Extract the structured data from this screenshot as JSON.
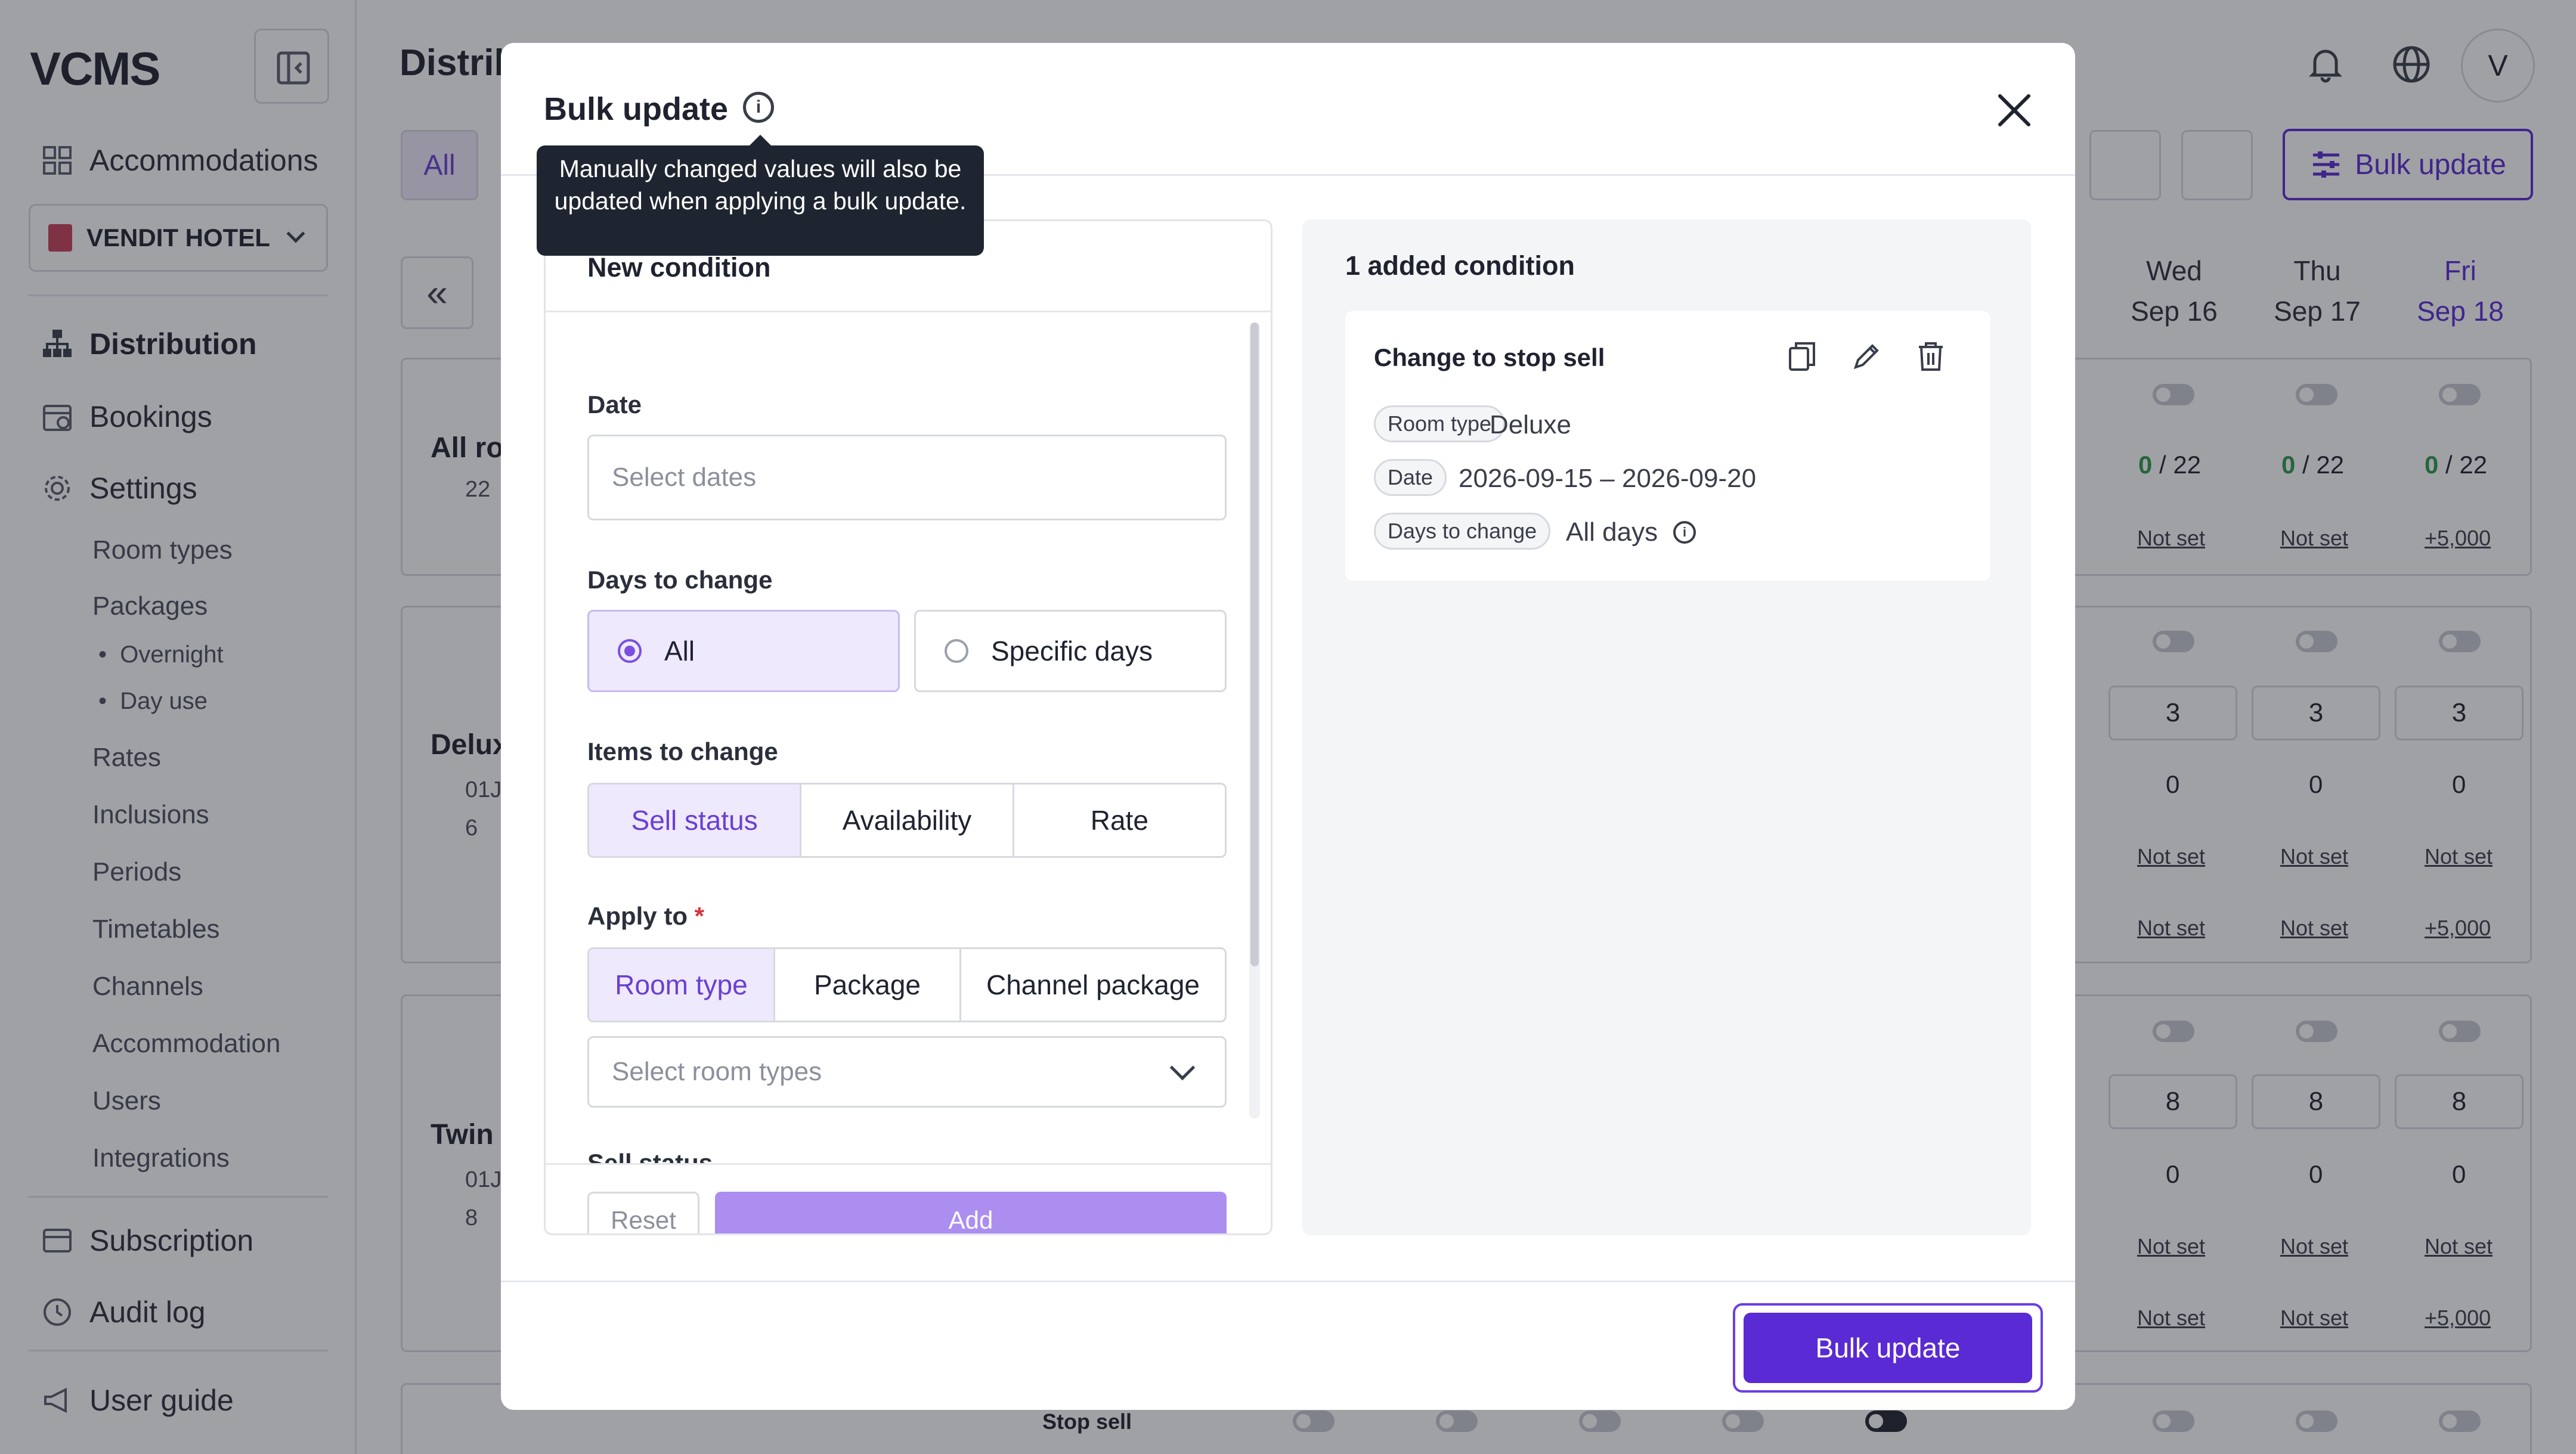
{
  "app": {
    "logo": "VCMS",
    "hotel": "VENDIT HOTEL",
    "page_title": "Distrib",
    "avatar": "V",
    "sidebar": {
      "accommodations": "Accommodations",
      "distribution": "Distribution",
      "bookings": "Bookings",
      "settings": "Settings",
      "settings_items": [
        "Room types",
        "Packages",
        "Rates",
        "Inclusions",
        "Periods",
        "Timetables",
        "Channels",
        "Accommodation",
        "Users",
        "Integrations"
      ],
      "packages_items": [
        "Overnight",
        "Day use"
      ],
      "subscription": "Subscription",
      "audit_log": "Audit log",
      "user_guide": "User guide"
    },
    "toolbar": {
      "filter_all": "All",
      "bulk_update": "Bulk update",
      "prev": "«"
    },
    "days": [
      {
        "dow": "Wed",
        "date": "Sep 16"
      },
      {
        "dow": "Thu",
        "date": "Sep 17"
      },
      {
        "dow": "Fri",
        "date": "Sep 18"
      }
    ],
    "grid": {
      "row_all": "All ro",
      "row_all_count": "22",
      "row_deluxe": "Delux",
      "row_deluxe_a": "01J",
      "row_deluxe_b": "6",
      "row_twin": "Twin",
      "row_twin_a": "01J",
      "row_twin_b": "8",
      "avail_all": [
        "0",
        "/ 22"
      ],
      "not_set": "Not set",
      "plus_price": "+5,000",
      "deluxe_units": "3",
      "twin_units": "8",
      "zero": "0",
      "stop_sell": "Stop sell"
    }
  },
  "modal": {
    "title": "Bulk update",
    "tooltip": "Manually changed values will also be updated when applying a bulk update.",
    "new_condition": {
      "heading": "New condition",
      "date_label": "Date",
      "date_placeholder": "Select dates",
      "days_label": "Days to change",
      "days_options": [
        "All",
        "Specific days"
      ],
      "items_label": "Items to change",
      "items_options": [
        "Sell status",
        "Availability",
        "Rate"
      ],
      "apply_label": "Apply to",
      "apply_required": "*",
      "apply_options": [
        "Room type",
        "Package",
        "Channel package"
      ],
      "room_types_placeholder": "Select room types",
      "next_label": "Sell status",
      "reset": "Reset",
      "add": "Add"
    },
    "added": {
      "heading": "1 added condition",
      "condition": {
        "title": "Change to stop sell",
        "room_type_chip": "Room type",
        "room_type_value": "Deluxe",
        "date_chip": "Date",
        "date_value": "2026-09-15 – 2026-09-20",
        "days_chip": "Days to change",
        "days_value": "All days"
      }
    },
    "submit": "Bulk update"
  },
  "colors": {
    "accent": "#5a2ad4",
    "accent_light": "#efe9fd",
    "available_green": "#2e9a4a"
  },
  "icons": [
    "sidebar-collapse-icon",
    "grid-icon",
    "hotel-icon",
    "sitemap-icon",
    "calendar-icon",
    "gear-icon",
    "receipt-icon",
    "clock-icon",
    "megaphone-icon",
    "bell-icon",
    "globe-icon",
    "info-icon",
    "refresh-icon",
    "sliders-icon",
    "close-icon",
    "copy-icon",
    "pencil-icon",
    "trash-icon",
    "chevron-down-icon"
  ]
}
